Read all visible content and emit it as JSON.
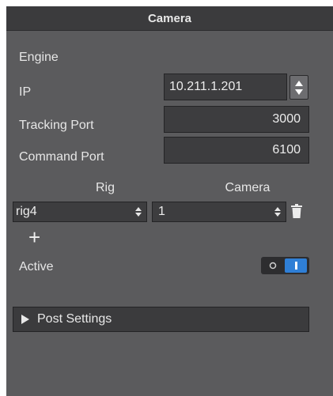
{
  "panel": {
    "title": "Camera"
  },
  "engine": {
    "section_label": "Engine",
    "ip_label": "IP",
    "ip_value": "10.211.1.201",
    "tracking_port_label": "Tracking Port",
    "tracking_port_value": "3000",
    "command_port_label": "Command Port",
    "command_port_value": "6100"
  },
  "rig_table": {
    "rig_header": "Rig",
    "camera_header": "Camera",
    "rows": [
      {
        "rig": "rig4",
        "camera": "1"
      }
    ],
    "add_label": "+"
  },
  "active": {
    "label": "Active",
    "toggle_on": true
  },
  "post_settings": {
    "label": "Post Settings",
    "expanded": false
  },
  "colors": {
    "panel_bg": "#5b5b5d",
    "header_bg": "#3b3b3d",
    "field_bg": "#3d3d3f",
    "toggle_accent": "#2f7fd6"
  },
  "icons": {
    "spinner": "up-down-arrows-icon",
    "select_arrow": "select-arrows-icon",
    "delete": "trash-icon",
    "expand": "triangle-right-icon"
  }
}
